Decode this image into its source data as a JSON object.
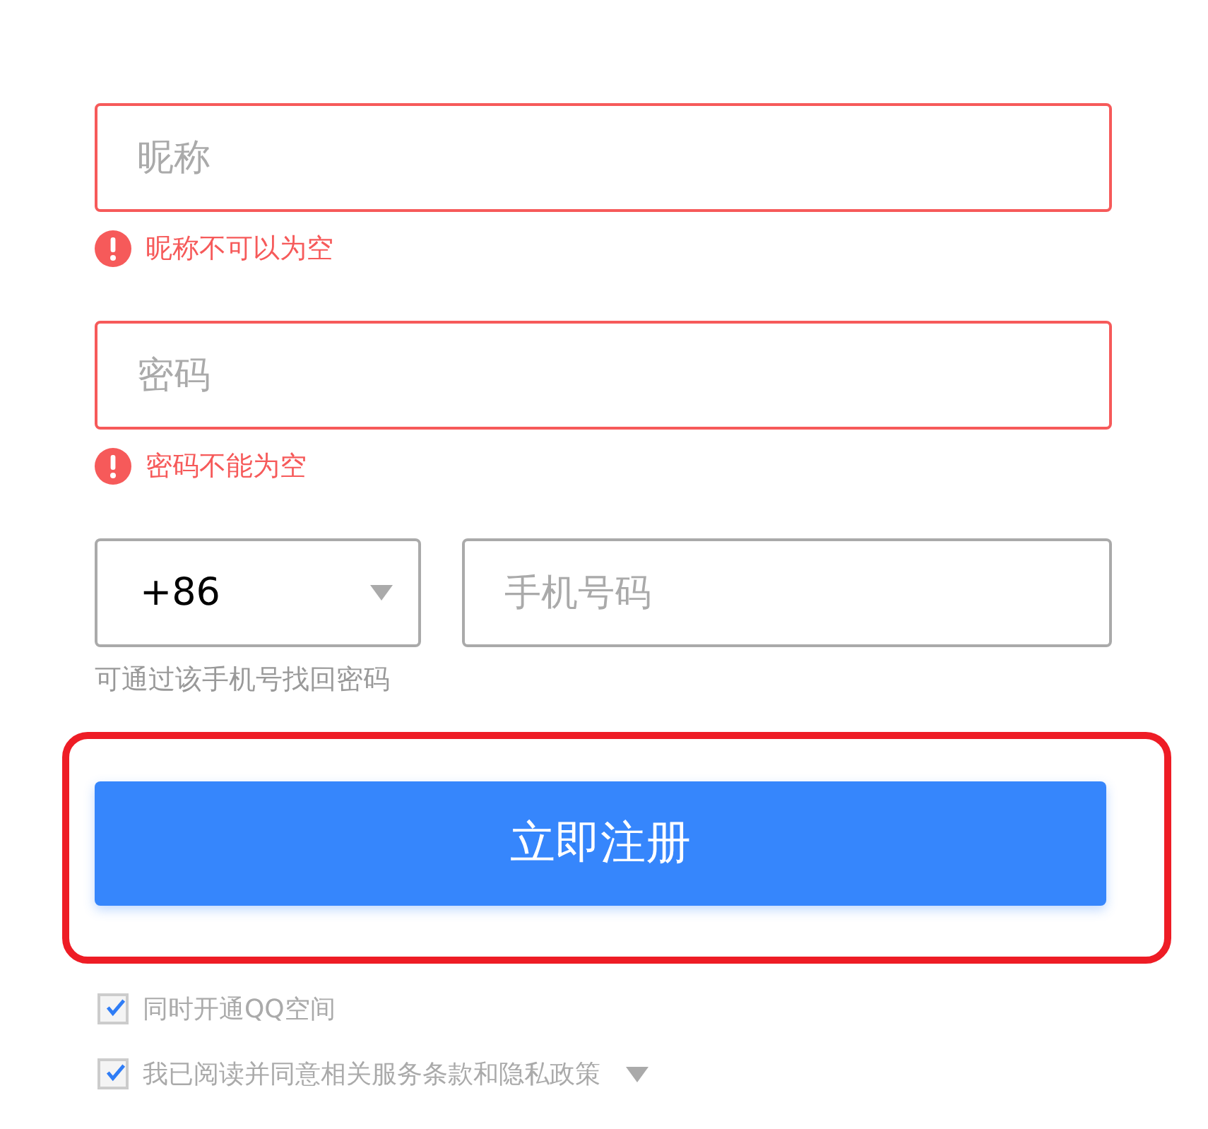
{
  "fields": [
    {
      "placeholder": "昵称",
      "error": "昵称不可以为空"
    },
    {
      "placeholder": "密码",
      "error": "密码不能为空"
    }
  ],
  "phone": {
    "country_code": "+86",
    "placeholder": "手机号码",
    "hint": "可通过该手机号找回密码"
  },
  "submit": {
    "label": "立即注册",
    "highlighted": true
  },
  "options": [
    {
      "label": "同时开通QQ空间",
      "checked": true,
      "has_menu": false
    },
    {
      "label": "我已阅读并同意相关服务条款和隐私政策",
      "checked": true,
      "has_menu": true
    }
  ]
}
